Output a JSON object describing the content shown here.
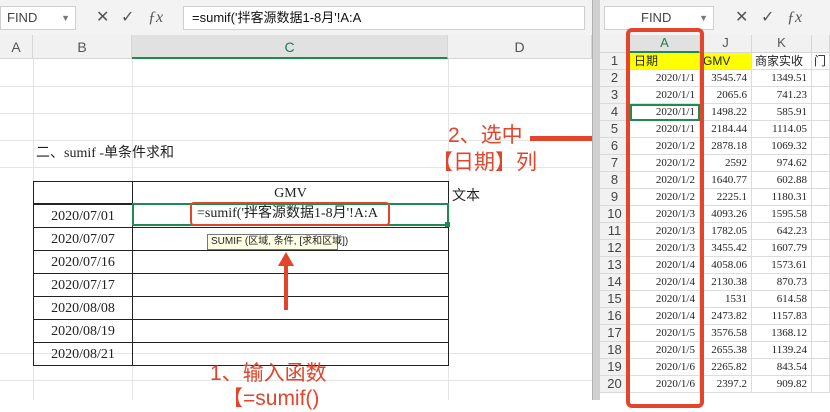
{
  "left": {
    "namebox": "FIND",
    "formula": "=sumif('拌客源数据1-8月'!A:A",
    "cols": [
      "A",
      "B",
      "C",
      "D"
    ],
    "section_title": "二、sumif -单条件求和",
    "table_header": "GMV",
    "side_label": "文本",
    "dates": [
      "2020/07/01",
      "2020/07/07",
      "2020/07/16",
      "2020/07/17",
      "2020/08/08",
      "2020/08/19",
      "2020/08/21"
    ],
    "active_cell": "=sumif('拌客源数据1-8月'!A:A",
    "tooltip": "SUMIF (区域, 条件, [求和区域])",
    "annotation_line1": "1、输入函数",
    "annotation_line2": "【=sumif()"
  },
  "right": {
    "namebox": "FIND",
    "cols": [
      "A",
      "J",
      "K",
      ""
    ],
    "header_row": [
      "日期",
      "GMV",
      "商家实收",
      "门店"
    ],
    "rows": [
      [
        "2020/1/1",
        "3545.74",
        "1349.51"
      ],
      [
        "2020/1/1",
        "2065.6",
        "741.23"
      ],
      [
        "2020/1/1",
        "1498.22",
        "585.91"
      ],
      [
        "2020/1/1",
        "2184.44",
        "1114.05"
      ],
      [
        "2020/1/2",
        "2878.18",
        "1069.32"
      ],
      [
        "2020/1/2",
        "2592",
        "974.62"
      ],
      [
        "2020/1/2",
        "1640.77",
        "602.88"
      ],
      [
        "2020/1/2",
        "2225.1",
        "1180.31"
      ],
      [
        "2020/1/3",
        "4093.26",
        "1595.58"
      ],
      [
        "2020/1/3",
        "1782.05",
        "642.23"
      ],
      [
        "2020/1/3",
        "3455.42",
        "1607.79"
      ],
      [
        "2020/1/4",
        "4058.06",
        "1573.61"
      ],
      [
        "2020/1/4",
        "2130.38",
        "870.73"
      ],
      [
        "2020/1/4",
        "1531",
        "614.58"
      ],
      [
        "2020/1/4",
        "2473.82",
        "1157.83"
      ],
      [
        "2020/1/5",
        "3576.58",
        "1368.12"
      ],
      [
        "2020/1/5",
        "2655.38",
        "1139.24"
      ],
      [
        "2020/1/6",
        "2265.82",
        "843.54"
      ],
      [
        "2020/1/6",
        "2397.2",
        "909.82"
      ]
    ],
    "row_numbers": [
      "1",
      "2",
      "3",
      "4",
      "5",
      "6",
      "7",
      "8",
      "9",
      "10",
      "11",
      "12",
      "13",
      "14",
      "15",
      "16",
      "17",
      "18",
      "19",
      "20"
    ],
    "annotation_line1": "2、选中",
    "annotation_line2": "【日期】列"
  },
  "colors": {
    "accent_red": "#e2452c",
    "selection_green": "#1e8c4e",
    "header_yellow": "#ffff00"
  }
}
